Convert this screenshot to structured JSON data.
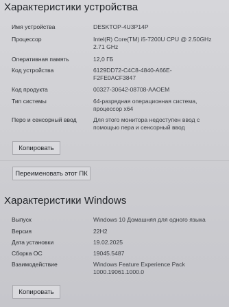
{
  "device_specs": {
    "title": "Характеристики устройства",
    "rows": [
      {
        "label": "Имя устройства",
        "value": "DESKTOP-4U3P14P"
      },
      {
        "label": "Процессор",
        "value": "Intel(R) Core(TM) i5-7200U CPU @ 2.50GHz 2.71 GHz"
      },
      {
        "label": "Оперативная память",
        "value": "12,0 ГБ"
      },
      {
        "label": "Код устройства",
        "value": "6129DD72-C4C8-4840-A66E-F2FE0ACF3847"
      },
      {
        "label": "Код продукта",
        "value": "00327-30642-08708-AAOEM"
      },
      {
        "label": "Тип системы",
        "value": "64-разрядная операционная система, процессор x64"
      },
      {
        "label": "Перо и сенсорный ввод",
        "value": "Для этого монитора недоступен ввод с помощью пера и сенсорный ввод"
      }
    ],
    "copy_button": "Копировать",
    "rename_button": "Переименовать этот ПК"
  },
  "windows_specs": {
    "title": "Характеристики Windows",
    "rows": [
      {
        "label": "Выпуск",
        "value": "Windows 10 Домашняя для одного языка"
      },
      {
        "label": "Версия",
        "value": "22H2"
      },
      {
        "label": "Дата установки",
        "value": "19.02.2025"
      },
      {
        "label": "Сборка ОС",
        "value": "19045.5487"
      },
      {
        "label": "Взаимодействие",
        "value": "Windows Feature Experience Pack 1000.19061.1000.0"
      }
    ],
    "copy_button": "Копировать"
  }
}
